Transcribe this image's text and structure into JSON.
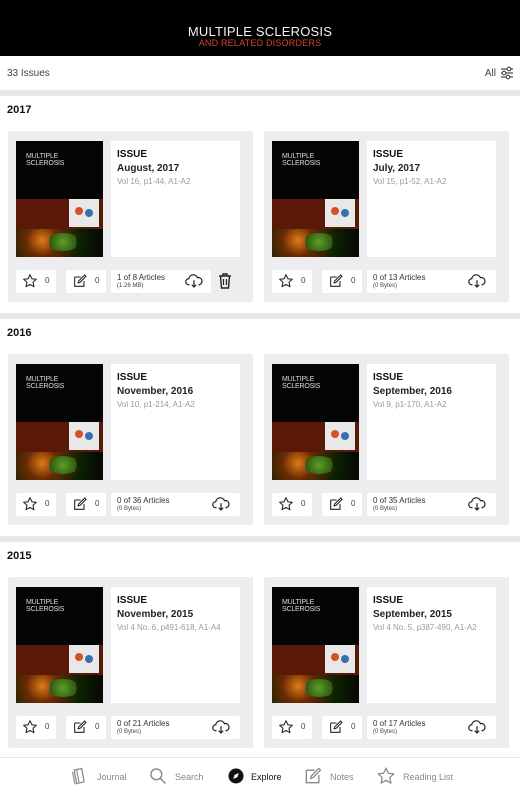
{
  "header": {
    "title_line1": "MULTIPLE SCLEROSIS",
    "title_line2": "AND RELATED DISORDERS"
  },
  "filter": {
    "issue_count": "33 Issues",
    "filter_label": "All",
    "filter_icon": "sliders-icon"
  },
  "cover": {
    "line1": "MULTIPLE",
    "line2": "SCLEROSIS"
  },
  "sections": [
    {
      "year": "2017",
      "issues": [
        {
          "label": "ISSUE",
          "date": "August, 2017",
          "volume": "Vol 16, p1-44, A1-A2",
          "stars": "0",
          "notes": "0",
          "articles": "1 of 8 Articles",
          "size": "(1.26 MB)",
          "has_delete": true
        },
        {
          "label": "ISSUE",
          "date": "July, 2017",
          "volume": "Vol 15, p1-52, A1-A2",
          "stars": "0",
          "notes": "0",
          "articles": "0 of 13 Articles",
          "size": "(0 Bytes)",
          "has_delete": false
        }
      ]
    },
    {
      "year": "2016",
      "issues": [
        {
          "label": "ISSUE",
          "date": "November, 2016",
          "volume": "Vol 10, p1-214, A1-A2",
          "stars": "0",
          "notes": "0",
          "articles": "0 of 36 Articles",
          "size": "(0 Bytes)",
          "has_delete": false
        },
        {
          "label": "ISSUE",
          "date": "September, 2016",
          "volume": "Vol 9, p1-170, A1-A2",
          "stars": "0",
          "notes": "0",
          "articles": "0 of 35 Articles",
          "size": "(0 Bytes)",
          "has_delete": false
        }
      ]
    },
    {
      "year": "2015",
      "issues": [
        {
          "label": "ISSUE",
          "date": "November, 2015",
          "volume": "Vol 4 No. 6, p491-618, A1-A4",
          "stars": "0",
          "notes": "0",
          "articles": "0 of 21 Articles",
          "size": "(0 Bytes)",
          "has_delete": false
        },
        {
          "label": "ISSUE",
          "date": "September, 2015",
          "volume": "Vol 4 No. 5, p387-490, A1-A2",
          "stars": "0",
          "notes": "0",
          "articles": "0 of 17 Articles",
          "size": "(0 Bytes)",
          "has_delete": false
        }
      ]
    }
  ],
  "tabs": [
    {
      "label": "Journal",
      "icon": "journal-icon",
      "active": false
    },
    {
      "label": "Search",
      "icon": "search-icon",
      "active": false
    },
    {
      "label": "Explore",
      "icon": "compass-icon",
      "active": true
    },
    {
      "label": "Notes",
      "icon": "note-icon",
      "active": false
    },
    {
      "label": "Reading List",
      "icon": "star-icon",
      "active": false
    }
  ]
}
